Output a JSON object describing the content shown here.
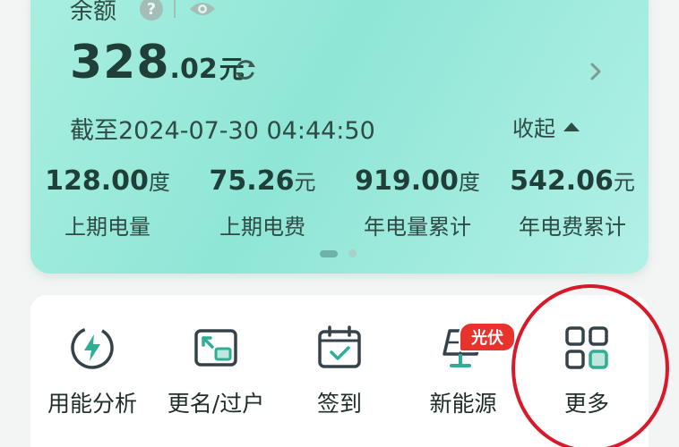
{
  "balance": {
    "label": "余额",
    "help_glyph": "?",
    "amount_int": "328",
    "amount_dec": ".02",
    "amount_unit": "元",
    "as_of": "截至2024-07-30 04:44:50",
    "collapse_label": "收起"
  },
  "stats": [
    {
      "value": "128.00",
      "unit": "度",
      "label": "上期电量"
    },
    {
      "value": "75.26",
      "unit": "元",
      "label": "上期电费"
    },
    {
      "value": "919.00",
      "unit": "度",
      "label": "年电量累计"
    },
    {
      "value": "542.06",
      "unit": "元",
      "label": "年电费累计"
    }
  ],
  "pager": {
    "total": 2,
    "active": 1
  },
  "services": [
    {
      "label": "用能分析",
      "icon": "lightning-icon"
    },
    {
      "label": "更名/过户",
      "icon": "transfer-icon"
    },
    {
      "label": "签到",
      "icon": "calendar-check-icon"
    },
    {
      "label": "新能源",
      "icon": "solar-panel-icon",
      "badge": "光伏"
    },
    {
      "label": "更多",
      "icon": "grid-icon"
    }
  ],
  "colors": {
    "accent": "#1f8f80",
    "card_gradient_start": "#a9efe0",
    "badge_red": "#e8322c",
    "highlight_ring": "#d8192a"
  }
}
